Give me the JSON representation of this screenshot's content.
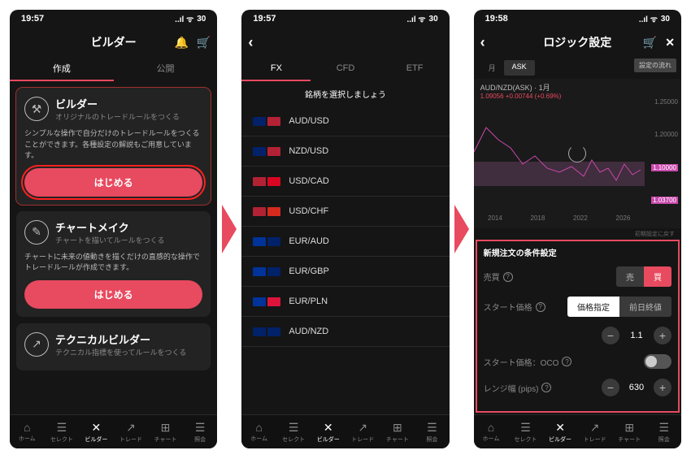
{
  "status": {
    "time1": "19:57",
    "time2": "19:57",
    "time3": "19:58",
    "battery": "30",
    "signal": "..ıl ᯤ"
  },
  "screen1": {
    "title": "ビルダー",
    "tabs": [
      "作成",
      "公開"
    ],
    "cards": [
      {
        "icon": "✕",
        "title": "ビルダー",
        "sub": "オリジナルのトレードルールをつくる",
        "desc": "シンプルな操作で自分だけのトレードルールをつくることができます。各種設定の解説もご用意しています。",
        "btn": "はじめる"
      },
      {
        "icon": "⟆",
        "title": "チャートメイク",
        "sub": "チャートを描いてルールをつくる",
        "desc": "チャートに未来の値動きを描くだけの直感的な操作でトレードルールが作成できます。",
        "btn": "はじめる"
      },
      {
        "icon": "↗",
        "title": "テクニカルビルダー",
        "sub": "テクニカル指標を使ってルールをつくる"
      }
    ]
  },
  "screen2": {
    "tabs": [
      "FX",
      "CFD",
      "ETF"
    ],
    "subtitle": "銘柄を選択しましょう",
    "pairs": [
      {
        "name": "AUD/USD",
        "f1": "#012169",
        "f2": "#b22234"
      },
      {
        "name": "NZD/USD",
        "f1": "#012169",
        "f2": "#b22234"
      },
      {
        "name": "USD/CAD",
        "f1": "#b22234",
        "f2": "#d80621"
      },
      {
        "name": "USD/CHF",
        "f1": "#b22234",
        "f2": "#d52b1e"
      },
      {
        "name": "EUR/AUD",
        "f1": "#003399",
        "f2": "#012169"
      },
      {
        "name": "EUR/GBP",
        "f1": "#003399",
        "f2": "#012169"
      },
      {
        "name": "EUR/PLN",
        "f1": "#003399",
        "f2": "#dc143c"
      },
      {
        "name": "AUD/NZD",
        "f1": "#012169",
        "f2": "#012169"
      }
    ]
  },
  "screen3": {
    "title": "ロジック設定",
    "flow_btn": "設定の流れ",
    "period": {
      "items": [
        "月",
        "ASK"
      ]
    },
    "chart": {
      "pair": "AUD/NZD(ASK) · 1月",
      "price": "1.09056 +0.00744 (+0.69%)",
      "ylabels": [
        "1.25000",
        "1.20000",
        "1.10000",
        "1.03700"
      ],
      "xlabels": [
        "2014",
        "2018",
        "2022",
        "2026"
      ]
    },
    "tiny_note": "初期設定に戻す",
    "cond_title": "新規注文の条件設定",
    "rows": {
      "buysell": {
        "label": "売買",
        "sell": "売",
        "buy": "買"
      },
      "start_price": {
        "label": "スタート価格",
        "opt1": "価格指定",
        "opt2": "前日終値"
      },
      "value1": "1.1",
      "oco": "スタート価格：OCO",
      "range": {
        "label": "レンジ幅 (pips)",
        "value": "630"
      }
    }
  },
  "botnav": [
    "ホーム",
    "セレクト",
    "ビルダー",
    "トレード",
    "チャート",
    "照会"
  ],
  "icons": {
    "bell": "🔔",
    "cart": "🛒",
    "close": "✕",
    "back": "‹",
    "home": "⌂",
    "select": "☰",
    "builder": "✕",
    "trade": "↗",
    "chart": "⊞",
    "inquiry": "☰"
  }
}
